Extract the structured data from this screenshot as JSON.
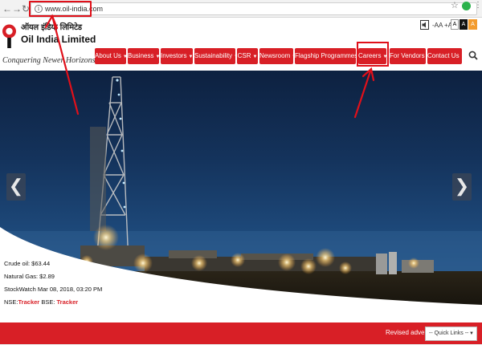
{
  "browser": {
    "back_icon": "back-arrow-icon",
    "forward_icon": "forward-arrow-icon",
    "reload_icon": "reload-icon",
    "url": "www.oil-india.com",
    "bookmark_icon": "star-icon",
    "extension_color": "#2bb24c"
  },
  "header": {
    "logo_hindi": "ऑयल इंडिया लिमिटेड",
    "logo_name": "Oil India Limited",
    "tagline": "Conquering Newer Horizons",
    "accessibility": {
      "font_small": "-A",
      "font_normal": "A",
      "font_large": "+A",
      "contrast_white": "A",
      "contrast_black": "A",
      "contrast_orange": "A"
    },
    "nav": [
      {
        "label": "About Us"
      },
      {
        "label": "Business"
      },
      {
        "label": "Investors"
      },
      {
        "label": "Sustainability"
      },
      {
        "label": "CSR"
      },
      {
        "label": "Newsroom"
      },
      {
        "label": "Flagship Programmes"
      },
      {
        "label": "Careers"
      },
      {
        "label": "For Vendors"
      },
      {
        "label": "Contact Us"
      }
    ],
    "search_icon": "search-icon"
  },
  "hero": {
    "prev_icon": "chevron-left-icon",
    "next_icon": "chevron-right-icon",
    "prev_label": "❮",
    "next_label": "❯",
    "stats": {
      "crude_oil": "Crude oil: $63.44",
      "natural_gas": "Natural Gas: $2.89",
      "stockwatch": "StockWatch Mar 08, 2018, 03:20 PM",
      "nse_label": "NSE:",
      "nse_link": "Tracker",
      "bse_label": "BSE:",
      "bse_link": "Tracker"
    }
  },
  "footer_bar": {
    "ticker": "Revised advert",
    "quick_links": "-- Quick Links --"
  },
  "colors": {
    "brand_red": "#d81f26",
    "annotation_red": "#e0101a"
  }
}
